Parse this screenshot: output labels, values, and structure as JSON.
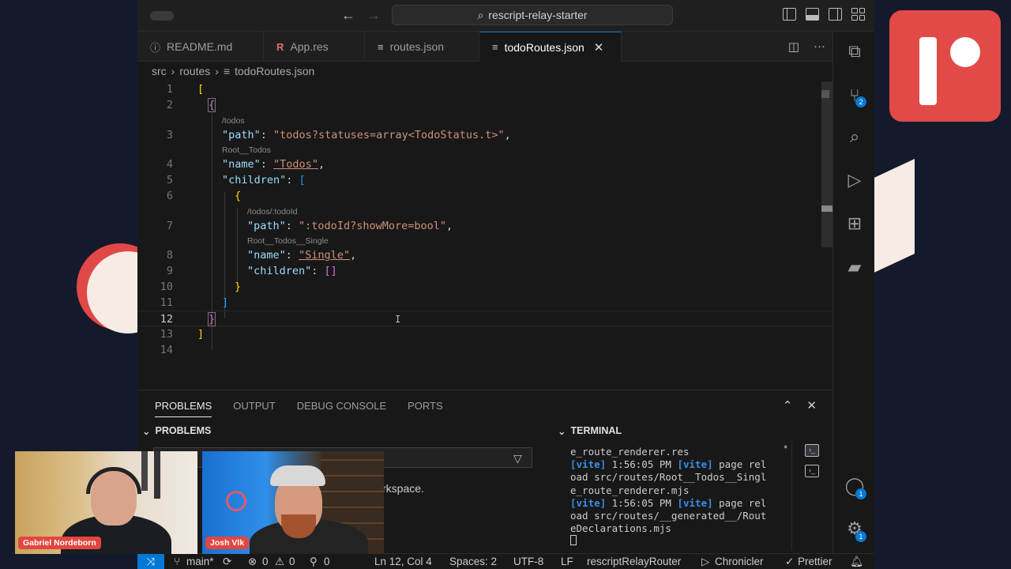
{
  "window": {
    "search": "rescript-relay-starter"
  },
  "tabs": [
    {
      "label": "README.md",
      "icon": "info-icon"
    },
    {
      "label": "App.res",
      "icon": "rescript-icon"
    },
    {
      "label": "routes.json",
      "icon": "json-icon"
    },
    {
      "label": "todoRoutes.json",
      "icon": "json-icon",
      "active": true
    }
  ],
  "breadcrumb": {
    "a": "src",
    "b": "routes",
    "c": "todoRoutes.json"
  },
  "code": {
    "hints": {
      "h3": "/todos",
      "h4": "Root__Todos",
      "h7": "/todos/:todoId",
      "h8": "Root__Todos__Single"
    },
    "lines": {
      "l3_key": "\"path\"",
      "l3_val": "\"todos?statuses=array<TodoStatus.t>\"",
      "l4_key": "\"name\"",
      "l4_val": "\"Todos\"",
      "l5_key": "\"children\"",
      "l7_key": "\"path\"",
      "l7_val": "\":todoId?showMore=bool\"",
      "l8_key": "\"name\"",
      "l8_val": "\"Single\"",
      "l9_key": "\"children\""
    }
  },
  "panel": {
    "tabs": [
      "PROBLEMS",
      "OUTPUT",
      "DEBUG CONSOLE",
      "PORTS"
    ],
    "problems_header": "PROBLEMS",
    "terminal_header": "TERMINAL",
    "no_problems_text": "rkspace.",
    "terminal_lines": [
      "e_route_renderer.res",
      "[vite] 1:56:05 PM [vite] page rel",
      "oad src/routes/Root__Todos__Singl",
      "e_route_renderer.mjs",
      "[vite] 1:56:05 PM [vite] page rel",
      "oad src/routes/__generated__/Rout",
      "eDeclarations.mjs"
    ]
  },
  "activity": {
    "scm_badge": "2",
    "accounts_badge": "1",
    "settings_badge": "1"
  },
  "status": {
    "branch": "main*",
    "errors": "0",
    "warnings": "0",
    "ports": "0",
    "position": "Ln 12, Col 4",
    "spaces": "Spaces: 2",
    "encoding": "UTF-8",
    "eol": "LF",
    "language": "rescriptRelayRouter",
    "chronicler": "Chronicler",
    "prettier": "Prettier"
  },
  "webcams": {
    "left_name": "Gabriel Nordeborn",
    "right_name": "Josh Vlk"
  },
  "colors": {
    "accent": "#0078d4",
    "patreon": "#e24a48"
  }
}
